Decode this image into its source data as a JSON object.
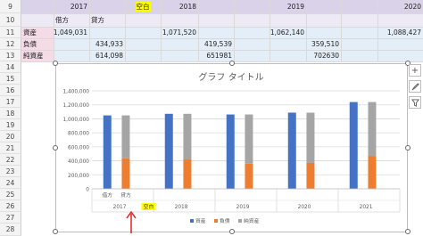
{
  "sheet": {
    "row_numbers": [
      "9",
      "10",
      "11",
      "12",
      "13",
      "14",
      "15",
      "16",
      "17",
      "18",
      "19",
      "20",
      "21",
      "22",
      "23",
      "24",
      "25",
      "26",
      "27",
      "28"
    ],
    "row10": {
      "debit": "借方",
      "credit": "貸方"
    },
    "years_header": {
      "y2017": "2017",
      "blank": "空白",
      "y2018": "2018",
      "y2019": "2019",
      "y2020": "2020"
    },
    "row11": {
      "label": "資産",
      "v2017": "1,049,031",
      "v2018": "1,071,520",
      "v2019": "1,062,140",
      "v2020": "1,088,427"
    },
    "row12": {
      "label": "負債",
      "v2017": "434,933",
      "v2018": "419,539",
      "v2019": "359,510"
    },
    "row13": {
      "label": "純資産",
      "v2017": "614,098",
      "v2018": "651981",
      "v2019": "702630"
    }
  },
  "chart_data": {
    "type": "bar",
    "title": "グラフ タイトル",
    "y_ticks": [
      "1,400,000",
      "1,200,000",
      "1,000,000",
      "800,000",
      "600,000",
      "400,000",
      "200,000",
      "0"
    ],
    "ylim": [
      0,
      1400000
    ],
    "sub_categories": [
      "借方",
      "貸方"
    ],
    "year_labels": [
      "2017",
      "2018",
      "2019",
      "2020",
      "2021"
    ],
    "blank_label": "空白",
    "series": [
      {
        "name": "資産",
        "color": "#4472c4",
        "values": [
          1049031,
          1071520,
          1062140,
          1088427,
          1240000
        ]
      },
      {
        "name": "負債",
        "color": "#ed7d31",
        "values": [
          434933,
          419539,
          359510,
          370000,
          470000
        ]
      },
      {
        "name": "純資産",
        "color": "#a5a5a5",
        "values": [
          614098,
          651981,
          702630,
          718000,
          770000
        ]
      }
    ]
  },
  "side_buttons": {
    "add": "+",
    "style": "🖌",
    "filter": "⏷"
  }
}
